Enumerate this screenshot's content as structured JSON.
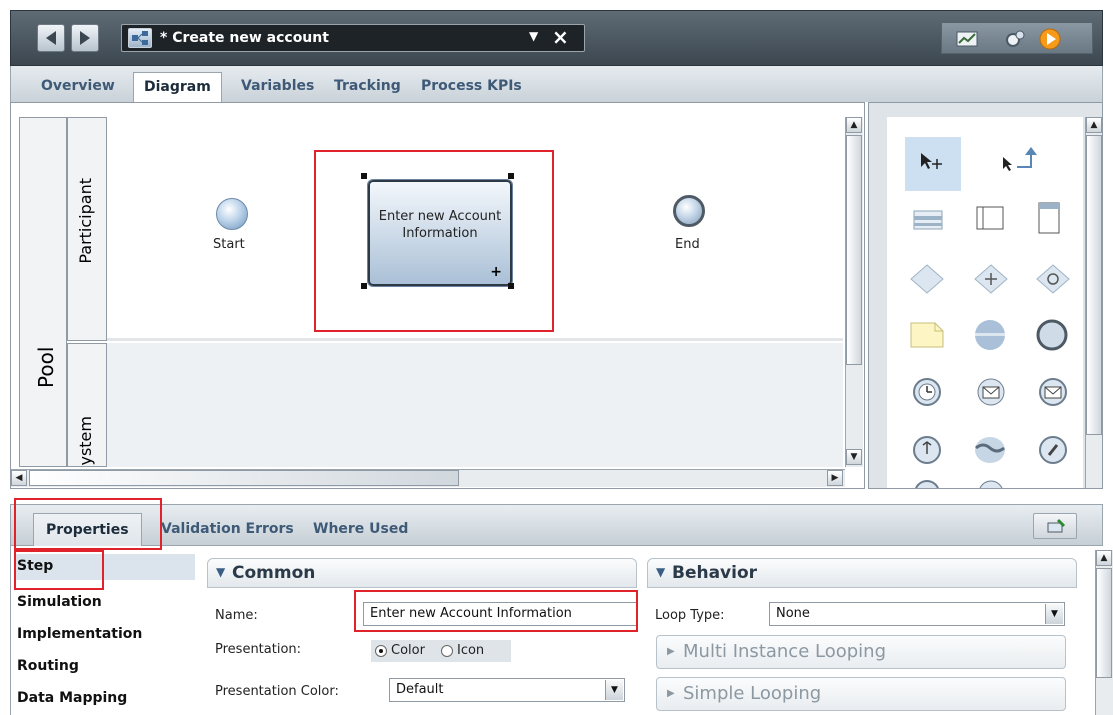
{
  "window": {
    "process_title": "* Create new account"
  },
  "tabs": [
    {
      "label": "Overview"
    },
    {
      "label": "Diagram"
    },
    {
      "label": "Variables"
    },
    {
      "label": "Tracking"
    },
    {
      "label": "Process KPIs"
    }
  ],
  "diagram": {
    "pool_label": "Pool",
    "lanes": [
      {
        "label": "Participant"
      },
      {
        "label": "System"
      }
    ],
    "start_label": "Start",
    "end_label": "End",
    "task_label": "Enter new Account Information"
  },
  "properties": {
    "tabs": [
      {
        "label": "Properties"
      },
      {
        "label": "Validation Errors"
      },
      {
        "label": "Where Used"
      }
    ],
    "categories": [
      "Step",
      "Simulation",
      "Implementation",
      "Routing",
      "Data Mapping"
    ],
    "common": {
      "header": "Common",
      "name_label": "Name:",
      "name_value": "Enter new Account Information",
      "presentation_label": "Presentation:",
      "presentation_options": [
        "Color",
        "Icon"
      ],
      "presentation_selected": "Color",
      "color_label": "Presentation Color:",
      "color_value": "Default"
    },
    "behavior": {
      "header": "Behavior",
      "loop_label": "Loop Type:",
      "loop_value": "None",
      "multi_instance": "Multi Instance Looping",
      "simple": "Simple Looping"
    }
  },
  "colors": {
    "highlight": "#e0232a",
    "titlebar": "#4a5660",
    "task_fill": "#a9bfd6"
  }
}
